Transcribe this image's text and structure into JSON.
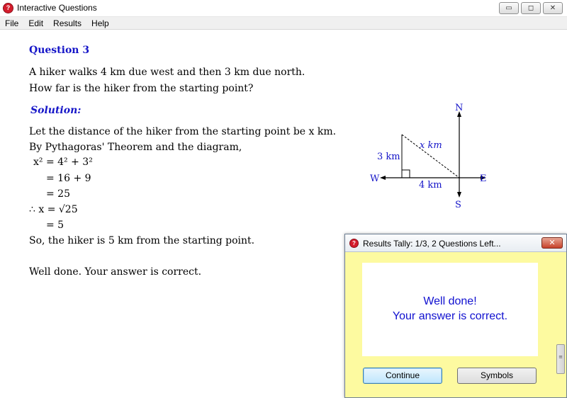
{
  "window": {
    "title": "Interactive Questions",
    "icon": "question-app-icon",
    "controls": {
      "minimize": "▭",
      "maximize": "◻",
      "close": "✕"
    }
  },
  "menu": [
    "File",
    "Edit",
    "Results",
    "Help"
  ],
  "question": {
    "title": "Question 3",
    "text": [
      "A hiker walks 4 km due west and then 3 km due north.",
      "How far is the hiker from the starting point?"
    ]
  },
  "solution": {
    "heading": "Solution:",
    "lines": [
      "Let the distance of the hiker from the starting point be x km.",
      "By Pythagoras' Theorem and the diagram,"
    ],
    "math": {
      "m1": "x² = 4² + 3²",
      "m2": "= 16 + 9",
      "m3": "= 25",
      "m4": "∴ x = √25",
      "m5": "= 5"
    },
    "conclusion": "So, the hiker is 5 km from the starting point.",
    "feedback": "Well done.  Your answer is correct."
  },
  "diagram": {
    "north": "N",
    "south": "S",
    "west": "W",
    "east": "E",
    "side_vertical": "3 km",
    "side_horizontal": "4 km",
    "hypotenuse": "x km"
  },
  "dialog": {
    "title": "Results Tally: 1/3, 2 Questions Left...",
    "close_label": "✕",
    "message_line1": "Well done!",
    "message_line2": "Your answer is correct.",
    "continue_label": "Continue",
    "symbols_label": "Symbols"
  },
  "colors": {
    "accent_blue": "#1515c8",
    "dialog_bg": "#fdfaa0",
    "icon_red": "#d41c2c"
  }
}
